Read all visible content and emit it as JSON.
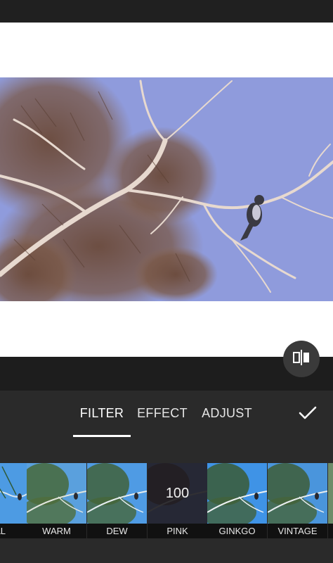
{
  "editor": {
    "tabs": [
      {
        "label": "FILTER",
        "active": true
      },
      {
        "label": "EFFECT",
        "active": false
      },
      {
        "label": "ADJUST",
        "active": false
      }
    ],
    "apply_icon": "checkmark-icon",
    "compare_icon": "compare-split-icon"
  },
  "filters": {
    "selected": "PINK",
    "selected_intensity": "100",
    "items": [
      {
        "label": "RAL"
      },
      {
        "label": "WARM"
      },
      {
        "label": "DEW"
      },
      {
        "label": "PINK"
      },
      {
        "label": "GINKGO"
      },
      {
        "label": "VINTAGE"
      }
    ]
  },
  "colors": {
    "photo_sky": "#8f9bdc",
    "thumb_sky": "#4d9be3",
    "panel_bg": "#2a2a2a",
    "accent": "#ffffff"
  }
}
